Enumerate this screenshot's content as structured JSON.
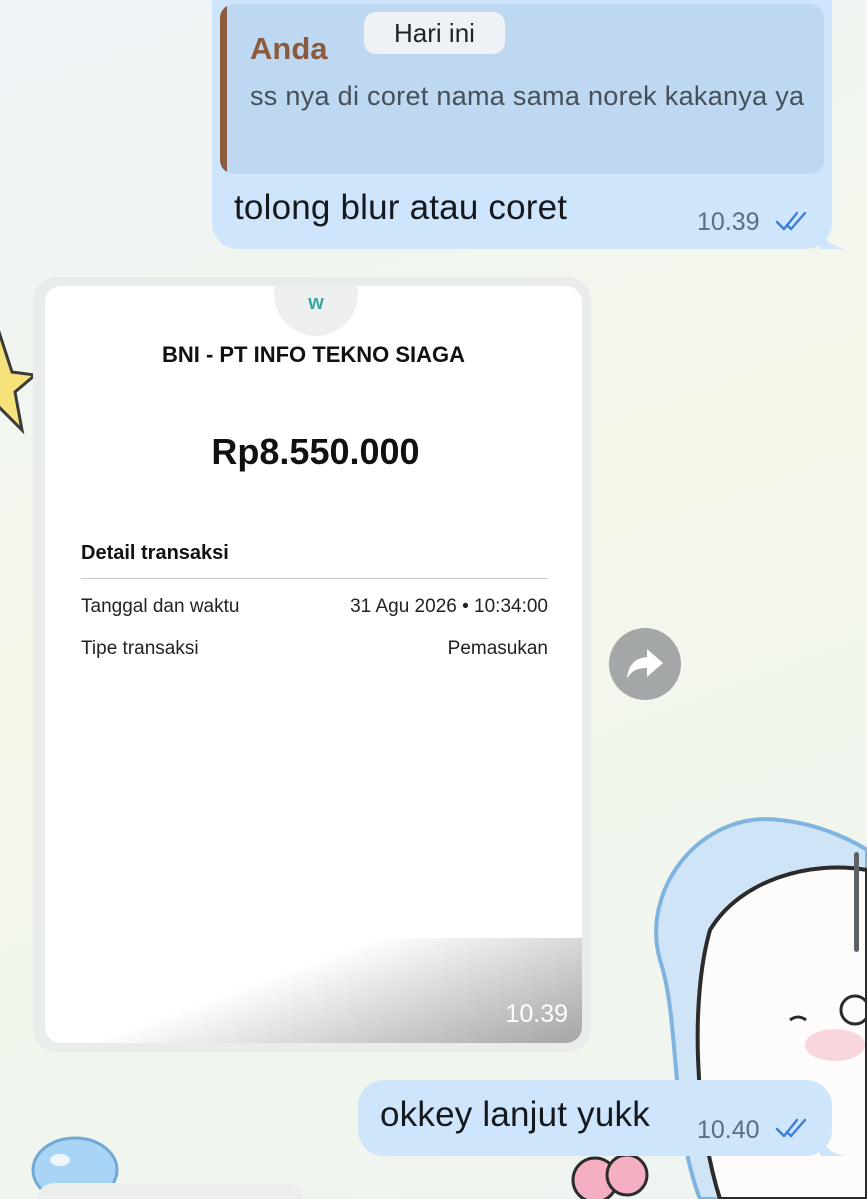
{
  "date_chip": "Hari ini",
  "messages": [
    {
      "direction": "outgoing",
      "reply": {
        "sender": "Anda",
        "text": "ss nya di coret nama sama norek kakanya ya"
      },
      "text": "tolong blur atau coret",
      "time": "10.39",
      "status": "read-double-check-icon"
    },
    {
      "direction": "incoming",
      "type": "image",
      "time": "10.39",
      "receipt": {
        "merchant": "BNI - PT INFO TEKNO SIAGA",
        "amount": "Rp8.550.000",
        "detail_heading": "Detail transaksi",
        "rows": [
          {
            "label": "Tanggal dan waktu",
            "value": "31 Agu 2026 • 10:34:00"
          },
          {
            "label": "Tipe transaksi",
            "value": "Pemasukan"
          }
        ]
      }
    },
    {
      "direction": "outgoing",
      "text": "okkey lanjut yukk",
      "time": "10.40",
      "status": "read-double-check-icon"
    }
  ],
  "icons": {
    "forward": "forward-arrow-icon",
    "read_status": "double-check-icon"
  },
  "colors": {
    "outgoing_bubble": "#cfe5fb",
    "reply_accent": "#8c5a3c",
    "check_blue": "#3d7ed8",
    "receipt_logo": "#3aa6a0"
  }
}
